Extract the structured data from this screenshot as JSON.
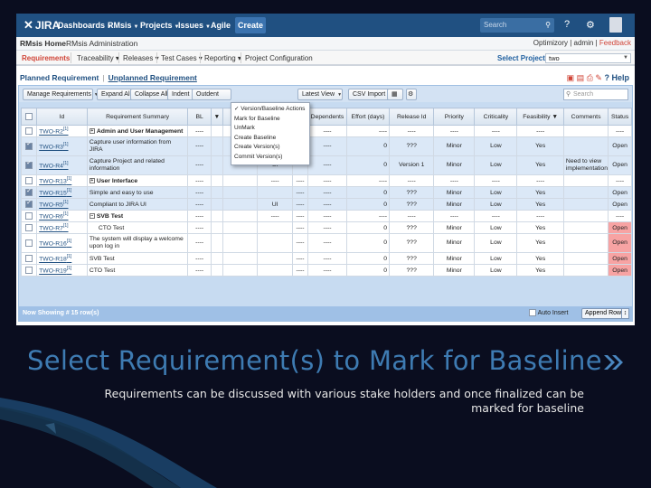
{
  "header": {
    "logo": "JIRA",
    "nav": [
      "Dashboards",
      "RMsis",
      "Projects",
      "Issues",
      "Agile"
    ],
    "create_label": "Create",
    "search_placeholder": "Search"
  },
  "rmsis_bar": {
    "home": "RMsis Home",
    "admin": "RMsis Administration",
    "links": [
      "Optimizory",
      "admin",
      "Feedback"
    ]
  },
  "menu": {
    "items": [
      "Requirements",
      "Traceability",
      "Releases",
      "Test Cases",
      "Reporting",
      "Project Configuration"
    ],
    "select_project_label": "Select Project:",
    "select_project_value": "two"
  },
  "subtabs": {
    "planned": "Planned Requirement",
    "unplanned": "Unplanned Requirement",
    "help": "Help"
  },
  "toolbar": {
    "manage": "Manage Requirements",
    "expand": "Expand All",
    "collapse": "Collapse All",
    "indent": "Indent",
    "outdent": "Outdent",
    "latest_view": "Latest View",
    "csv_import": "CSV Import",
    "search_placeholder": "Search"
  },
  "version_menu": {
    "items": [
      "✓ Version/Baseline Actions",
      "Mark for Baseline",
      "UnMark",
      "Create Baseline",
      "Create Version(s)",
      "Commit Version(s)"
    ]
  },
  "columns": [
    "Id",
    "Requirement Summary",
    "BL",
    "Dependents",
    "Effort (days)",
    "Release Id",
    "Priority",
    "Criticality",
    "Feasibility",
    "Comments",
    "Status"
  ],
  "rows": [
    {
      "checked": false,
      "id": "TWO-R2",
      "sup": "[1]",
      "summary": "Admin and User Management",
      "group": true,
      "bl": "----",
      "c6": "----",
      "c7": "----",
      "dep": "----",
      "effort": "----",
      "release": "----",
      "priority": "----",
      "criticality": "----",
      "feasibility": "----",
      "comments": "",
      "status": "----"
    },
    {
      "checked": true,
      "id": "TWO-R3",
      "sup": "[1]",
      "summary": "Capture user information from JIRA",
      "bl": "----",
      "c6": "",
      "c7": "----",
      "dep": "----",
      "effort": "0",
      "release": "???",
      "priority": "Minor",
      "criticality": "Low",
      "feasibility": "Yes",
      "comments": "",
      "status": "Open",
      "tall": true
    },
    {
      "checked": true,
      "id": "TWO-R4",
      "sup": "[1]",
      "summary": "Capture Project and related information",
      "bl": "----",
      "c6": "UI",
      "c7": "----",
      "dep": "----",
      "effort": "0",
      "release": "Version 1",
      "priority": "Minor",
      "criticality": "Low",
      "feasibility": "Yes",
      "comments": "Need to view implementation",
      "status": "Open",
      "tall": true
    },
    {
      "checked": false,
      "id": "TWO-R13",
      "sup": "[1]",
      "summary": "User Interface",
      "group": true,
      "bl": "----",
      "c6": "----",
      "c7": "----",
      "dep": "----",
      "effort": "----",
      "release": "----",
      "priority": "----",
      "criticality": "----",
      "feasibility": "----",
      "comments": "",
      "status": "----"
    },
    {
      "checked": true,
      "id": "TWO-R15",
      "sup": "[1]",
      "summary": "Simple and easy to use",
      "bl": "----",
      "c6": "",
      "c7": "----",
      "dep": "----",
      "effort": "0",
      "release": "???",
      "priority": "Minor",
      "criticality": "Low",
      "feasibility": "Yes",
      "comments": "",
      "status": "Open"
    },
    {
      "checked": true,
      "id": "TWO-R5",
      "sup": "[1]",
      "summary": "Compliant to JIRA UI",
      "bl": "----",
      "c6": "UI",
      "c7": "----",
      "dep": "----",
      "effort": "0",
      "release": "???",
      "priority": "Minor",
      "criticality": "Low",
      "feasibility": "Yes",
      "comments": "",
      "status": "Open"
    },
    {
      "checked": false,
      "id": "TWO-R6",
      "sup": "[1]",
      "summary": "SVB Test",
      "group": true,
      "minus": true,
      "bl": "----",
      "c6": "----",
      "c7": "----",
      "dep": "----",
      "effort": "----",
      "release": "----",
      "priority": "----",
      "criticality": "----",
      "feasibility": "----",
      "comments": "",
      "status": "----"
    },
    {
      "checked": false,
      "id": "TWO-R7",
      "sup": "[1]",
      "summary": "CTO Test",
      "indent": true,
      "bl": "----",
      "c6": "",
      "c7": "----",
      "dep": "----",
      "effort": "0",
      "release": "???",
      "priority": "Minor",
      "criticality": "Low",
      "feasibility": "Yes",
      "comments": "",
      "status": "Open",
      "red": true
    },
    {
      "checked": false,
      "id": "TWO-R16",
      "sup": "[1]",
      "summary": "The system will display a welcome upon log in",
      "bl": "----",
      "c6": "",
      "c7": "----",
      "dep": "----",
      "effort": "0",
      "release": "???",
      "priority": "Minor",
      "criticality": "Low",
      "feasibility": "Yes",
      "comments": "",
      "status": "Open",
      "red": true,
      "tall": true
    },
    {
      "checked": false,
      "id": "TWO-R18",
      "sup": "[1]",
      "summary": "SVB Test",
      "bl": "----",
      "c6": "",
      "c7": "----",
      "dep": "----",
      "effort": "0",
      "release": "???",
      "priority": "Minor",
      "criticality": "Low",
      "feasibility": "Yes",
      "comments": "",
      "status": "Open",
      "red": true
    },
    {
      "checked": false,
      "id": "TWO-R19",
      "sup": "[1]",
      "summary": "CTO Test",
      "bl": "----",
      "c6": "",
      "c7": "----",
      "dep": "----",
      "effort": "0",
      "release": "???",
      "priority": "Minor",
      "criticality": "Low",
      "feasibility": "Yes",
      "comments": "",
      "status": "Open",
      "red": true
    }
  ],
  "footer": {
    "showing": "Now Showing # 15 row(s)",
    "auto_insert": "Auto Insert",
    "append_row": "Append Row"
  },
  "slide": {
    "title": "Select Requirement(s) to Mark for Baseline",
    "subtitle": "Requirements can be discussed with various stake holders and once finalized can be marked for baseline"
  },
  "colors": {
    "jira_blue": "#205081",
    "status_red": "#f7a3a3",
    "title_blue": "#3e7bb2"
  }
}
